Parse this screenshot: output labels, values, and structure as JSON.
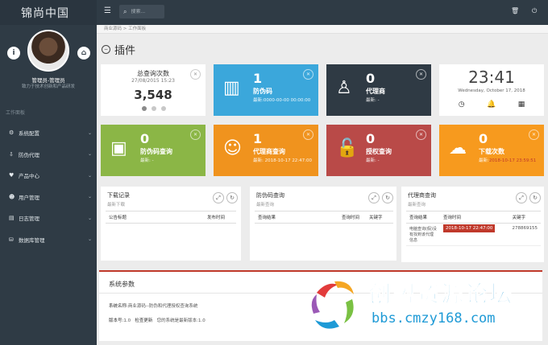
{
  "brand": "锦尚中国",
  "profile": {
    "name": "管理员-管理员",
    "tagline": "致力于技术创新和产品研发"
  },
  "sidebar": {
    "section": "工作面板",
    "items": [
      {
        "label": "系统配置",
        "icon": "gear-icon"
      },
      {
        "label": "防伪代理",
        "icon": "download-icon"
      },
      {
        "label": "产品中心",
        "icon": "heart-icon"
      },
      {
        "label": "用户管理",
        "icon": "users-icon"
      },
      {
        "label": "日志管理",
        "icon": "log-icon"
      },
      {
        "label": "数据库管理",
        "icon": "database-icon"
      }
    ]
  },
  "topbar": {
    "search_placeholder": "搜索..."
  },
  "breadcrumb": {
    "home": "商业源码",
    "current": "工作面板"
  },
  "page_title": "插件",
  "stats_card": {
    "title": "总查询次数",
    "date": "27/08/2015 15:23",
    "value": "3,548"
  },
  "cards": [
    {
      "value": "1",
      "label": "防伪码",
      "sub": "最新:0000-00-00 00:00:00",
      "color": "#3ba7db"
    },
    {
      "value": "0",
      "label": "代理商",
      "sub": "最新: -",
      "color": "#2f3a44"
    },
    {
      "value": "0",
      "label": "防伪码查询",
      "sub": "最新: -",
      "color": "#8bb646"
    },
    {
      "value": "1",
      "label": "代理商查询",
      "sub": "最新: 2018-10-17 22:47:00",
      "color": "#f0931e"
    },
    {
      "value": "0",
      "label": "授权查询",
      "sub": "最新: -",
      "color": "#b94a48"
    },
    {
      "value": "0",
      "label": "下载次数",
      "sub_prefix": "最新:",
      "sub": "2018-10-17 23:59:51",
      "color": "#f79a1e"
    }
  ],
  "clock": {
    "time": "23:41",
    "date": "Wednesday, October 17, 2018"
  },
  "panels": {
    "downloads": {
      "title": "下载记录",
      "subtitle": "最新下载",
      "columns": [
        "公告标题",
        "发布时间"
      ]
    },
    "code_query": {
      "title": "防伪码查询",
      "subtitle": "最新查询",
      "columns": [
        "查询结果",
        "查询时间",
        "关键字"
      ]
    },
    "agent_query": {
      "title": "代理商查询",
      "subtitle": "最新查询",
      "columns": [
        "查询结果",
        "查询时间",
        "关键字"
      ],
      "rows": [
        {
          "result": "电脑查询(假)没有找到该代理信息",
          "time": "2018-10-17 22:47:00",
          "keyword": "278869155"
        }
      ]
    }
  },
  "system": {
    "title": "系统参数",
    "name_label": "系统名称:",
    "name_value": "商业源码--防伪和代理授权查询系统",
    "version_label": "版本号:",
    "version_value": "1.0",
    "check_update": "检查更新",
    "update_status": "您的系统是最新版本:1.0"
  },
  "watermark": {
    "text": "创盟资源论坛",
    "url": "bbs.cmzy168.com"
  }
}
